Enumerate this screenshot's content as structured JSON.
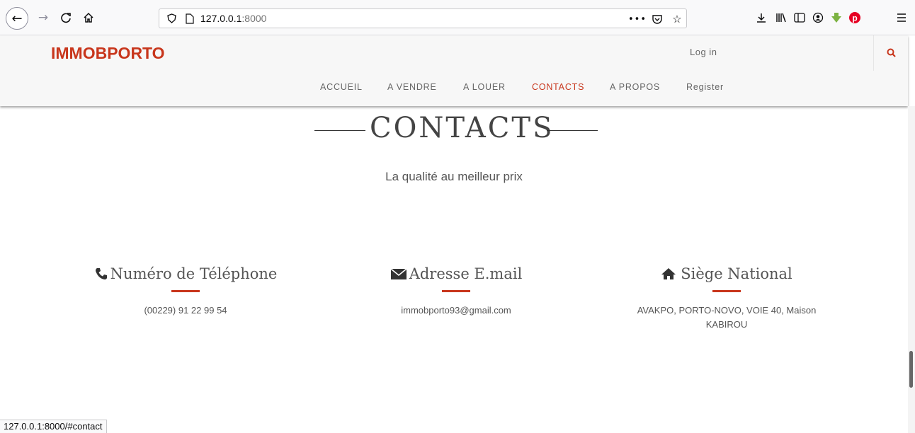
{
  "browser": {
    "url_host": "127.0.0.1",
    "url_port": ":8000",
    "page_actions_label": "•••",
    "status_url": "127.0.0.1:8000/#contact"
  },
  "header": {
    "brand": "IMMOBPORTO",
    "login": "Log in",
    "nav": [
      {
        "label": "ACCUEIL",
        "active": false
      },
      {
        "label": "A VENDRE",
        "active": false
      },
      {
        "label": "A LOUER",
        "active": false
      },
      {
        "label": "CONTACTS",
        "active": true
      },
      {
        "label": "A PROPOS",
        "active": false
      },
      {
        "label": "Register",
        "active": false
      }
    ]
  },
  "section": {
    "title": "CONTACTS",
    "subtitle": "La qualité au meilleur prix"
  },
  "contacts": [
    {
      "icon": "phone-icon",
      "heading": "Numéro de Téléphone",
      "text": "(00229) 91 22 99 54"
    },
    {
      "icon": "envelope-icon",
      "heading": "Adresse E.mail",
      "text": "immobporto93@gmail.com"
    },
    {
      "icon": "home-icon",
      "heading": "Siège National",
      "text": "AVAKPO, PORTO-NOVO, VOIE 40, Maison KABIROU"
    }
  ],
  "colors": {
    "accent": "#c8361c",
    "text": "#555555"
  }
}
